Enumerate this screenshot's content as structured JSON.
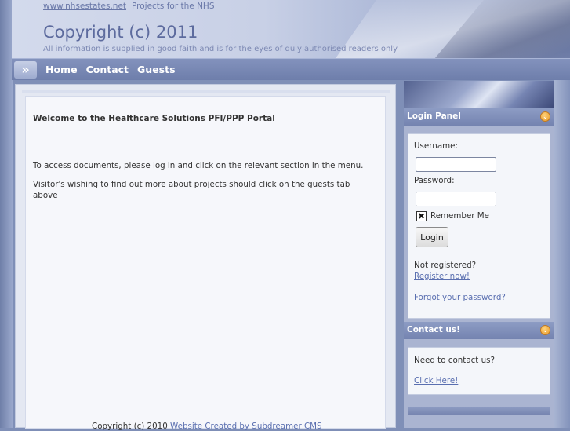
{
  "header": {
    "site_link": "www.nhsestates.net",
    "tagline": "Projects for the NHS",
    "title": "Copyright (c) 2011",
    "notice": "All information is supplied in good faith and is for the eyes of duly authorised readers only"
  },
  "nav": {
    "arrow_glyph": "»",
    "items": [
      "Home",
      "Contact",
      "Guests"
    ]
  },
  "main": {
    "welcome": "Welcome to the Healthcare Solutions PFI/PPP Portal",
    "para1": "To access documents, please log in and click on the relevant section in the menu.",
    "para2": "Visitor's wishing to find out more about projects should click on the guests tab above",
    "footer_text": "Copyright (c) 2010",
    "footer_link": "Website Created by Subdreamer CMS"
  },
  "login_panel": {
    "title": "Login Panel",
    "username_label": "Username:",
    "password_label": "Password:",
    "username_value": "",
    "password_value": "",
    "remember_label": "Remember Me",
    "remember_checked": true,
    "checkbox_glyph": "✖",
    "login_button": "Login",
    "not_registered": "Not registered?",
    "register_link": "Register now!",
    "forgot_link": "Forgot your password?"
  },
  "contact_panel": {
    "title": "Contact us!",
    "prompt": "Need to contact us?",
    "link": "Click Here!"
  },
  "toggle_glyph": "⌄"
}
